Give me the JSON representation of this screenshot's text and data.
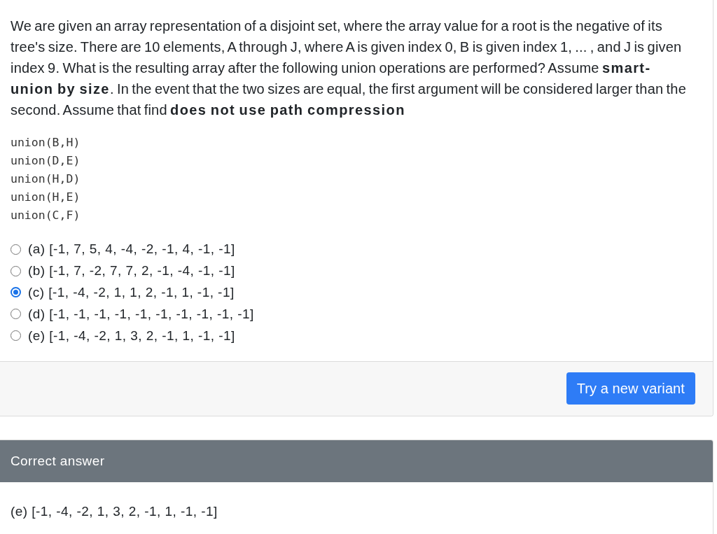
{
  "question": {
    "text": "We are given an array representation of a disjoint set, where the array value for a root is the negative of its tree's size. There are 10 elements, A through J, where A is given index 0, B is given index 1, ... , and J is given index 9. What is the resulting array after the following union operations are performed? Assume **smart-union by size**. In the event that the two sizes are equal, the first argument will be considered larger than the second. Assume that find **does not use path compression**",
    "code_lines": [
      "union(B,H)",
      "union(D,E)",
      "union(H,D)",
      "union(H,E)",
      "union(C,F)"
    ],
    "options": [
      {
        "text": "(a) [-1, 7, 5, 4, -4, -2, -1, 4, -1, -1]",
        "selected": false
      },
      {
        "text": "(b) [-1, 7, -2, 7, 7, 2, -1, -4, -1, -1]",
        "selected": false
      },
      {
        "text": "(c) [-1, -4, -2, 1, 1, 2, -1, 1, -1, -1]",
        "selected": true
      },
      {
        "text": "(d) [-1, -1, -1, -1, -1, -1, -1, -1, -1, -1]",
        "selected": false
      },
      {
        "text": "(e) [-1, -4, -2, 1, 3, 2, -1, 1, -1, -1]",
        "selected": false
      }
    ]
  },
  "footer": {
    "button": "Try a new variant"
  },
  "answer_panel": {
    "title": "Correct answer",
    "answer": "(e) [-1, -4, -2, 1, 3, 2, -1, 1, -1, -1]"
  }
}
